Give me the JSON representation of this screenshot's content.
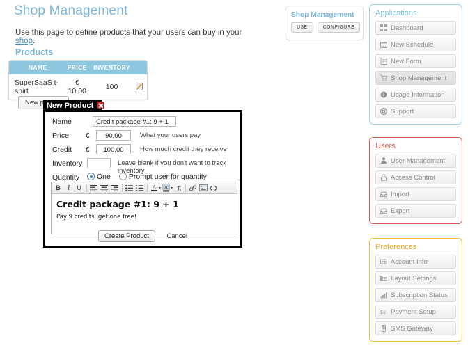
{
  "page": {
    "title": "Shop Management",
    "description_before": "Use this page to define products that your users can buy in your ",
    "description_link": "shop",
    "description_after": ".",
    "section_title": "Products"
  },
  "products_table": {
    "columns": [
      "NAME",
      "PRICE",
      "INVENTORY",
      ""
    ],
    "rows": [
      {
        "name": "SuperSaaS t-shirt",
        "price": "€ 10,00",
        "inventory": "100",
        "action_icon": "edit-icon"
      }
    ]
  },
  "buttons": {
    "new_product": "New product"
  },
  "modal": {
    "title": "New Product",
    "close_icon": "close-icon",
    "fields": {
      "name_label": "Name",
      "name_value": "Credit package #1: 9 + 1",
      "price_label": "Price",
      "price_currency": "€",
      "price_value": "90,00",
      "price_hint": "What your users pay",
      "credit_label": "Credit",
      "credit_currency": "€",
      "credit_value": "100,00",
      "credit_hint": "How much credit they receive",
      "inventory_label": "Inventory",
      "inventory_value": "",
      "inventory_hint": "Leave blank if you don't want to track inventory",
      "quantity_label": "Quantity",
      "quantity_option_one": "One",
      "quantity_option_prompt": "Prompt user for quantity",
      "quantity_selected": "One"
    },
    "editor": {
      "toolbar": [
        "bold-icon",
        "italic-icon",
        "underline-icon",
        "align-left-icon",
        "align-center-icon",
        "align-right-icon",
        "bullet-list-icon",
        "numbered-list-icon",
        "text-color-icon",
        "text-color-dropdown-icon",
        "highlight-color-icon",
        "highlight-color-dropdown-icon",
        "clear-formatting-icon",
        "link-icon",
        "image-icon",
        "source-code-icon"
      ],
      "heading": "Credit package #1: 9 + 1",
      "paragraph": "Pay 9 credits, get one free!"
    },
    "actions": {
      "create": "Create Product",
      "cancel": "Cancel"
    }
  },
  "app_card": {
    "title": "Shop Management",
    "use_label": "USE",
    "configure_label": "CONFIGURE"
  },
  "panels": [
    {
      "id": "applications",
      "title": "Applications",
      "accent": "#9ed3ea",
      "items": [
        {
          "label": "Dashboard",
          "icon": "grid-icon",
          "active": false
        },
        {
          "label": "New Schedule",
          "icon": "calendar-icon",
          "active": false
        },
        {
          "label": "New Form",
          "icon": "form-icon",
          "active": false
        },
        {
          "label": "Shop Management",
          "icon": "cart-icon",
          "active": true
        },
        {
          "label": "Usage Information",
          "icon": "info-icon",
          "active": false
        },
        {
          "label": "Support",
          "icon": "lifebuoy-icon",
          "active": false
        }
      ]
    },
    {
      "id": "users",
      "title": "Users",
      "accent": "#d95c4a",
      "items": [
        {
          "label": "User Management",
          "icon": "person-icon",
          "active": false
        },
        {
          "label": "Access Control",
          "icon": "lock-icon",
          "active": false
        },
        {
          "label": "Import",
          "icon": "inbox-in-icon",
          "active": false
        },
        {
          "label": "Export",
          "icon": "inbox-out-icon",
          "active": false
        }
      ]
    },
    {
      "id": "preferences",
      "title": "Preferences",
      "accent": "#f2bb3a",
      "items": [
        {
          "label": "Account Info",
          "icon": "id-card-icon",
          "active": false
        },
        {
          "label": "Layout Settings",
          "icon": "layout-icon",
          "active": false
        },
        {
          "label": "Subscription Status",
          "icon": "bar-chart-icon",
          "active": false
        },
        {
          "label": "Payment Setup",
          "icon": "currency-icon",
          "active": false
        },
        {
          "label": "SMS Gateway",
          "icon": "phone-icon",
          "active": false
        }
      ]
    }
  ]
}
